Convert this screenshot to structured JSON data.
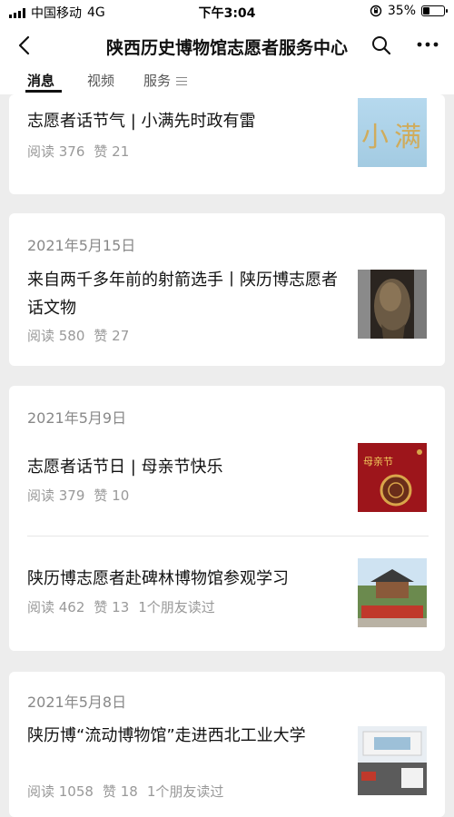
{
  "status": {
    "carrier": "中国移动",
    "network": "4G",
    "time": "下午3:04",
    "battery_level": "35%",
    "battery_fraction": 0.35
  },
  "nav": {
    "title": "陕西历史博物馆志愿者服务中心",
    "back_icon": "back-chevron-icon",
    "search_icon": "search-icon",
    "more_icon": "more-icon"
  },
  "tabs": [
    {
      "label": "消息",
      "active": true
    },
    {
      "label": "视频"
    },
    {
      "label": "服务"
    }
  ],
  "articles": [
    {
      "title": "志愿者话节气 | 小满先时政有雷",
      "reads": "阅读 376",
      "likes": "赞 21",
      "thumb_text": "小满"
    },
    {
      "date": "2021年5月15日",
      "title": "来自两千多年前的射箭选手丨陕历博志愿者话文物",
      "reads": "阅读 580",
      "likes": "赞 27"
    },
    {
      "date": "2021年5月9日",
      "title": "志愿者话节日 | 母亲节快乐",
      "reads": "阅读 379",
      "likes": "赞 10",
      "thumb_text": "母亲节"
    },
    {
      "title": "陕历博志愿者赴碑林博物馆参观学习",
      "reads": "阅读 462",
      "likes": "赞 13",
      "friends": "1个朋友读过"
    },
    {
      "date": "2021年5月8日",
      "title": "陕历博“流动博物馆”走进西北工业大学",
      "reads": "阅读 1058",
      "likes": "赞 18",
      "friends": "1个朋友读过"
    }
  ],
  "colors": {
    "background": "#ededed",
    "card": "#ffffff",
    "mother_day_red": "#a0161c",
    "sky_blue": "#a8cfe6"
  }
}
